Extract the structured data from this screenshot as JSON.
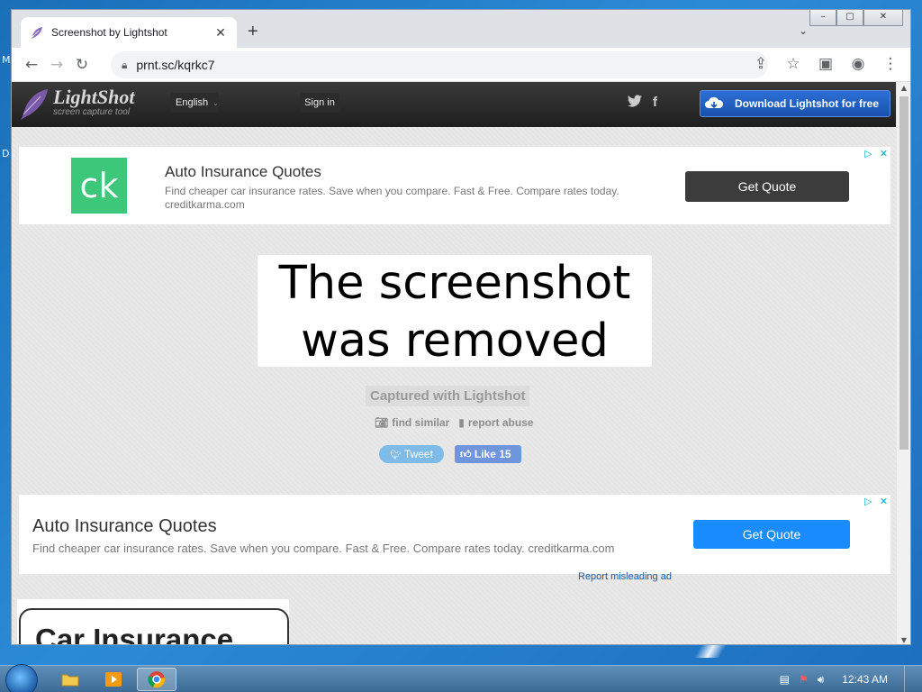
{
  "desktop": {
    "glyph_top": "M",
    "glyph_bottom": "D"
  },
  "browser": {
    "tab_title": "Screenshot by Lightshot",
    "tab_close": "✕",
    "new_tab": "+",
    "tab_search": "⌄",
    "window_controls": {
      "minimize": "–",
      "maximize": "▢",
      "close": "✕"
    },
    "url": "prnt.sc/kqrkc7"
  },
  "site": {
    "logo_name": "LightShot",
    "logo_tagline": "screen capture tool",
    "language": "English",
    "sign_in": "Sign in",
    "download_label": "Download Lightshot for free"
  },
  "ad_top": {
    "logo_text": "ck",
    "title": "Auto Insurance Quotes",
    "description": "Find cheaper car insurance rates. Save when you compare. Fast & Free. Compare rates today. creditkarma.com",
    "button": "Get Quote"
  },
  "main": {
    "removed_line1": "The screenshot",
    "removed_line2": "was removed",
    "captured": "Captured with Lightshot",
    "find_similar": "find similar",
    "report_abuse": "report abuse",
    "tweet": "Tweet",
    "like": "Like 15"
  },
  "ad_middle": {
    "title": "Auto Insurance Quotes",
    "description": "Find cheaper car insurance rates. Save when you compare. Fast & Free. Compare rates today. creditkarma.com",
    "button": "Get Quote",
    "report": "Report misleading ad"
  },
  "ad_bottom": {
    "title": "Car Insurance"
  },
  "taskbar": {
    "clock": "12:43 AM"
  },
  "colors": {
    "accent_blue": "#1a8cff",
    "ck_green": "#3cc77b",
    "header_dark": "#1e1e1e"
  }
}
